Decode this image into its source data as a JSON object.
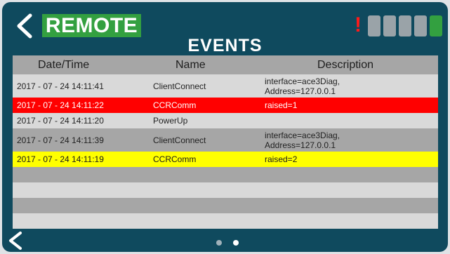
{
  "header": {
    "brand": "REMOTE",
    "alert_symbol": "!",
    "back_icon": "chevron-left-icon",
    "signal": {
      "total_bars": 5,
      "active_bars": 1,
      "active_color": "#33a040",
      "inactive_color": "#9aa3a8"
    }
  },
  "page": {
    "title": "EVENTS"
  },
  "table": {
    "columns": [
      "Date/Time",
      "Name",
      "Description"
    ],
    "rows": [
      {
        "datetime": "2017 - 07 - 24 14:11:41",
        "name": "ClientConnect",
        "desc1": "interface=ace3Diag,",
        "desc2": "Address=127.0.0.1",
        "style": "light"
      },
      {
        "datetime": "2017 - 07 - 24 14:11:22",
        "name": "CCRComm",
        "desc1": "raised=1",
        "desc2": "",
        "style": "red"
      },
      {
        "datetime": "2017 - 07 - 24 14:11:20",
        "name": "PowerUp",
        "desc1": "",
        "desc2": "",
        "style": "light"
      },
      {
        "datetime": "2017 - 07 - 24 14:11:39",
        "name": "ClientConnect",
        "desc1": "interface=ace3Diag,",
        "desc2": "Address=127.0.0.1",
        "style": "dark"
      },
      {
        "datetime": "2017 - 07 - 24 14:11:19",
        "name": "CCRComm",
        "desc1": "raised=2",
        "desc2": "",
        "style": "yellow"
      }
    ],
    "empty_rows": 4
  },
  "footer": {
    "pages": 2,
    "current_page": 2
  },
  "colors": {
    "background": "#0f4a5e",
    "accent": "#33a040",
    "error": "#ff0000",
    "warning": "#ffff00"
  }
}
